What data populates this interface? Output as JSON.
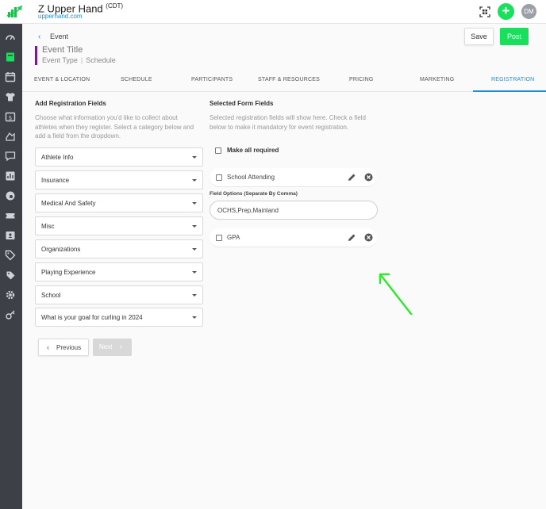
{
  "header": {
    "brand_name": "Z Upper Hand",
    "brand_tz": "(CDT)",
    "brand_link": "upperhand.com",
    "avatar_initials": "DM",
    "add_label": "+"
  },
  "sidebar": {
    "icons": [
      "dashboard-icon",
      "book-icon",
      "calendar-icon",
      "shirt-icon",
      "calendar-dollar-icon",
      "bill-icon",
      "chat-icon",
      "chart-icon",
      "palette-icon",
      "ticket-icon",
      "id-card-icon",
      "tag-icon",
      "tags-icon",
      "gear-icon",
      "key-icon"
    ]
  },
  "event": {
    "back_label": "Event",
    "title": "Event Title",
    "type": "Event Type",
    "schedule": "Schedule",
    "save_label": "Save",
    "post_label": "Post",
    "accent_color": "#7b1a8c"
  },
  "tabs": [
    "EVENT & LOCATION",
    "SCHEDULE",
    "PARTICIPANTS",
    "STAFF & RESOURCES",
    "PRICING",
    "MARKETING",
    "REGISTRATION"
  ],
  "active_tab": "REGISTRATION",
  "add_fields": {
    "heading": "Add Registration Fields",
    "description_lines": [
      "Choose what information you'd like to collect about",
      "athletes when they register. Select a category below and",
      "add a field from the dropdown."
    ],
    "dropdowns": [
      "Athlete Info",
      "Insurance",
      "Medical And Safety",
      "Misc",
      "Organizations",
      "Playing Experience",
      "School",
      "What is your goal for curling in 2024"
    ],
    "previous_label": "Previous",
    "next_label": "Next"
  },
  "selected_fields": {
    "heading": "Selected Form Fields",
    "description_lines": [
      "Selected registration fields will show here. Check a field",
      "below to make it mandatory for event registration."
    ],
    "make_all_required": "Make all required",
    "fields": [
      {
        "name": "School Attending"
      },
      {
        "name": "GPA"
      }
    ],
    "field_options_label": "Field Options (Separate By Comma)",
    "field_options_value": "OCHS,Prep,Mainland"
  },
  "colors": {
    "accent_blue": "#1e8fd6",
    "accent_green": "#18e05c",
    "sidebar_bg": "#3d4046"
  }
}
